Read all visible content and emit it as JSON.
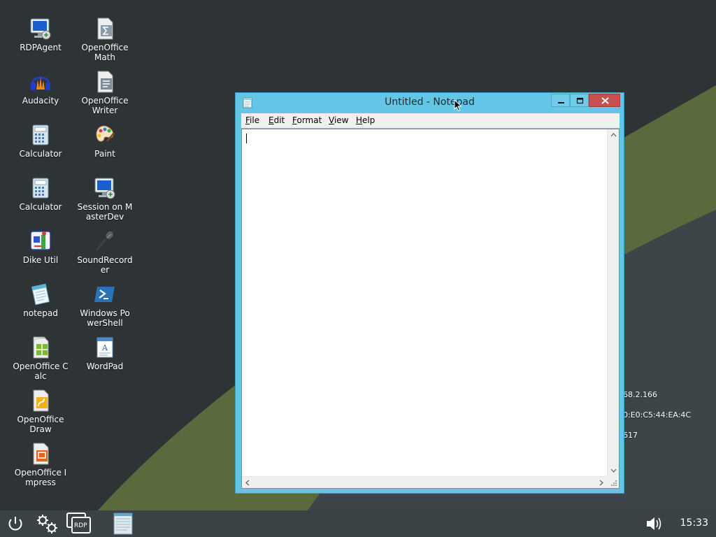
{
  "desktop": {
    "icons": [
      {
        "name": "rdpagent",
        "label": "RDPAgent",
        "icon": "monitor-remote-icon"
      },
      {
        "name": "openoffice-math",
        "label": "OpenOffice Math",
        "icon": "openoffice-math-icon"
      },
      {
        "name": "audacity",
        "label": "Audacity",
        "icon": "audacity-icon"
      },
      {
        "name": "openoffice-writer",
        "label": "OpenOffice Writer",
        "icon": "openoffice-writer-icon"
      },
      {
        "name": "calculator-1",
        "label": "Calculator",
        "icon": "calculator-icon"
      },
      {
        "name": "paint",
        "label": "Paint",
        "icon": "paint-palette-icon"
      },
      {
        "name": "calculator-2",
        "label": "Calculator",
        "icon": "calculator-icon"
      },
      {
        "name": "session-on-masterdev",
        "label": "Session on MasterDev",
        "icon": "monitor-remote-icon"
      },
      {
        "name": "dike-util",
        "label": "Dike Util",
        "icon": "dike-util-icon"
      },
      {
        "name": "soundrecorder",
        "label": "SoundRecorder",
        "icon": "microphone-icon"
      },
      {
        "name": "notepad",
        "label": "notepad",
        "icon": "notepad-icon"
      },
      {
        "name": "windows-powershell",
        "label": "Windows PowerShell",
        "icon": "powershell-icon"
      },
      {
        "name": "openoffice-calc",
        "label": "OpenOffice Calc",
        "icon": "openoffice-calc-icon"
      },
      {
        "name": "wordpad",
        "label": "WordPad",
        "icon": "wordpad-icon"
      },
      {
        "name": "openoffice-draw",
        "label": "OpenOffice Draw",
        "icon": "openoffice-draw-icon"
      },
      {
        "name": "openoffice-impress",
        "label": "OpenOffice Impress",
        "icon": "openoffice-impress-icon"
      }
    ],
    "info_lines": [
      "68.2.166",
      "0:E0:C5:44:EA:4C",
      "617"
    ]
  },
  "notepad": {
    "title": "Untitled - Notepad",
    "content": "",
    "menu": [
      {
        "label": "File",
        "accel": "F",
        "rest": "ile"
      },
      {
        "label": "Edit",
        "accel": "E",
        "rest": "dit"
      },
      {
        "label": "Format",
        "accel": "F",
        "rest": "ormat"
      },
      {
        "label": "View",
        "accel": "V",
        "rest": "iew"
      },
      {
        "label": "Help",
        "accel": "H",
        "rest": "elp"
      }
    ]
  },
  "taskbar": {
    "power_icon": "power-icon",
    "settings_icon": "gear-icon",
    "rdp_label": "RDP",
    "task_icon": "notepad-icon",
    "volume_icon": "volume-icon",
    "clock": "15:33"
  },
  "colors": {
    "desktop_bg": "#2e3336",
    "wallpaper_accent": "#5b6a3c",
    "window_frame": "#64c6e6",
    "close_button": "#c75050",
    "taskbar": "#3a4246"
  }
}
